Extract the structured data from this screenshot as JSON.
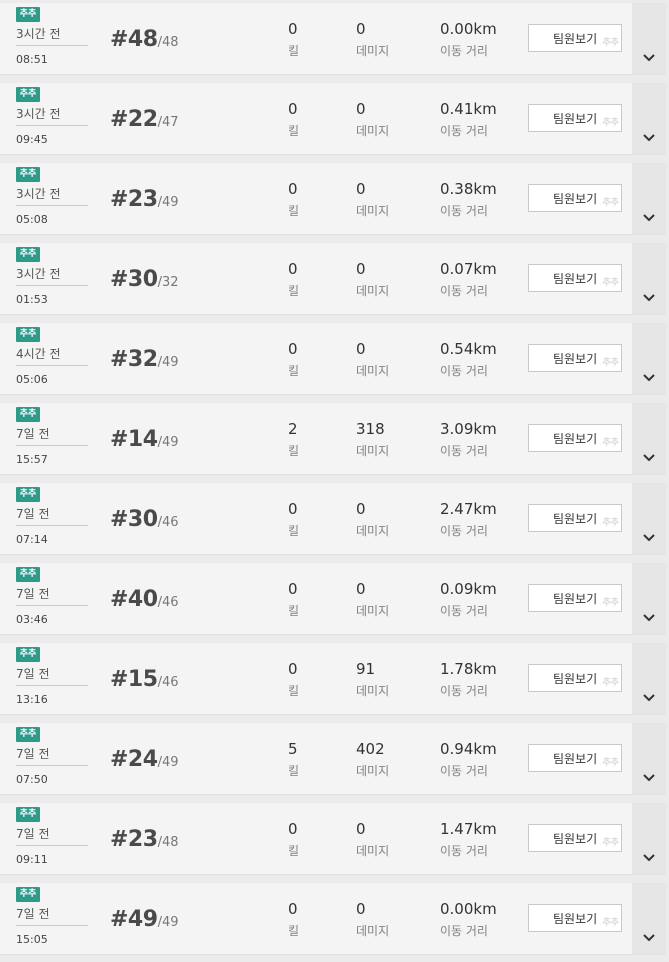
{
  "common": {
    "mode_badge": "추추",
    "kill_label": "킬",
    "damage_label": "데미지",
    "distance_label": "이동 거리",
    "team_button_label": "팀원보기",
    "team_button_watermark": "추추"
  },
  "matches": [
    {
      "ago": "3시간 전",
      "time": "08:51",
      "rank": "#48",
      "total": "/48",
      "kills": "0",
      "damage": "0",
      "distance": "0.00km"
    },
    {
      "ago": "3시간 전",
      "time": "09:45",
      "rank": "#22",
      "total": "/47",
      "kills": "0",
      "damage": "0",
      "distance": "0.41km"
    },
    {
      "ago": "3시간 전",
      "time": "05:08",
      "rank": "#23",
      "total": "/49",
      "kills": "0",
      "damage": "0",
      "distance": "0.38km"
    },
    {
      "ago": "3시간 전",
      "time": "01:53",
      "rank": "#30",
      "total": "/32",
      "kills": "0",
      "damage": "0",
      "distance": "0.07km"
    },
    {
      "ago": "4시간 전",
      "time": "05:06",
      "rank": "#32",
      "total": "/49",
      "kills": "0",
      "damage": "0",
      "distance": "0.54km"
    },
    {
      "ago": "7일 전",
      "time": "15:57",
      "rank": "#14",
      "total": "/49",
      "kills": "2",
      "damage": "318",
      "distance": "3.09km"
    },
    {
      "ago": "7일 전",
      "time": "07:14",
      "rank": "#30",
      "total": "/46",
      "kills": "0",
      "damage": "0",
      "distance": "2.47km"
    },
    {
      "ago": "7일 전",
      "time": "03:46",
      "rank": "#40",
      "total": "/46",
      "kills": "0",
      "damage": "0",
      "distance": "0.09km"
    },
    {
      "ago": "7일 전",
      "time": "13:16",
      "rank": "#15",
      "total": "/46",
      "kills": "0",
      "damage": "91",
      "distance": "1.78km"
    },
    {
      "ago": "7일 전",
      "time": "07:50",
      "rank": "#24",
      "total": "/49",
      "kills": "5",
      "damage": "402",
      "distance": "0.94km"
    },
    {
      "ago": "7일 전",
      "time": "09:11",
      "rank": "#23",
      "total": "/48",
      "kills": "0",
      "damage": "0",
      "distance": "1.47km"
    },
    {
      "ago": "7일 전",
      "time": "15:05",
      "rank": "#49",
      "total": "/49",
      "kills": "0",
      "damage": "0",
      "distance": "0.00km"
    }
  ]
}
